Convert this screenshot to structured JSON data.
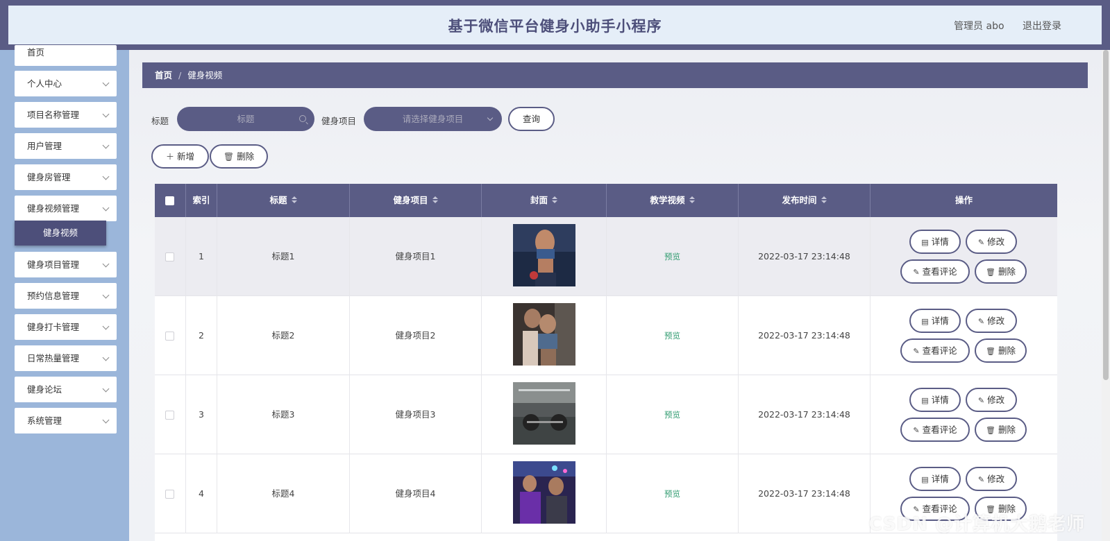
{
  "header": {
    "title": "基于微信平台健身小助手小程序",
    "user_label": "管理员 abo",
    "logout_label": "退出登录"
  },
  "sidebar": {
    "items": [
      {
        "label": "首页"
      },
      {
        "label": "个人中心"
      },
      {
        "label": "项目名称管理"
      },
      {
        "label": "用户管理"
      },
      {
        "label": "健身房管理"
      },
      {
        "label": "健身视频管理"
      },
      {
        "label": "健身项目管理"
      },
      {
        "label": "预约信息管理"
      },
      {
        "label": "健身打卡管理"
      },
      {
        "label": "日常热量管理"
      },
      {
        "label": "健身论坛"
      },
      {
        "label": "系统管理"
      }
    ],
    "active_sub": "健身视频"
  },
  "breadcrumb": {
    "home": "首页",
    "separator": "/",
    "current": "健身视频"
  },
  "search": {
    "title_label": "标题",
    "title_placeholder": "标题",
    "project_label": "健身项目",
    "project_placeholder": "请选择健身项目",
    "query_button": "查询"
  },
  "actions": {
    "add_label": "新增",
    "delete_label": "删除"
  },
  "table": {
    "columns": [
      "索引",
      "标题",
      "健身项目",
      "封面",
      "教学视频",
      "发布时间",
      "操作"
    ],
    "rows": [
      {
        "index": "1",
        "title": "标题1",
        "project": "健身项目1",
        "video": "预览",
        "time": "2022-03-17 23:14:48"
      },
      {
        "index": "2",
        "title": "标题2",
        "project": "健身项目2",
        "video": "预览",
        "time": "2022-03-17 23:14:48"
      },
      {
        "index": "3",
        "title": "标题3",
        "project": "健身项目3",
        "video": "预览",
        "time": "2022-03-17 23:14:48"
      },
      {
        "index": "4",
        "title": "标题4",
        "project": "健身项目4",
        "video": "预览",
        "time": "2022-03-17 23:14:48"
      }
    ],
    "row_actions": {
      "detail": "详情",
      "edit": "修改",
      "comments": "查看评论",
      "delete": "删除"
    }
  },
  "watermark": "CSDN @计算机大鹅老师",
  "colors": {
    "primary": "#5a5c85",
    "sidebar_bg": "#9bb6da",
    "header_bg": "#e5eef8",
    "preview_link": "#2f9b6f"
  }
}
